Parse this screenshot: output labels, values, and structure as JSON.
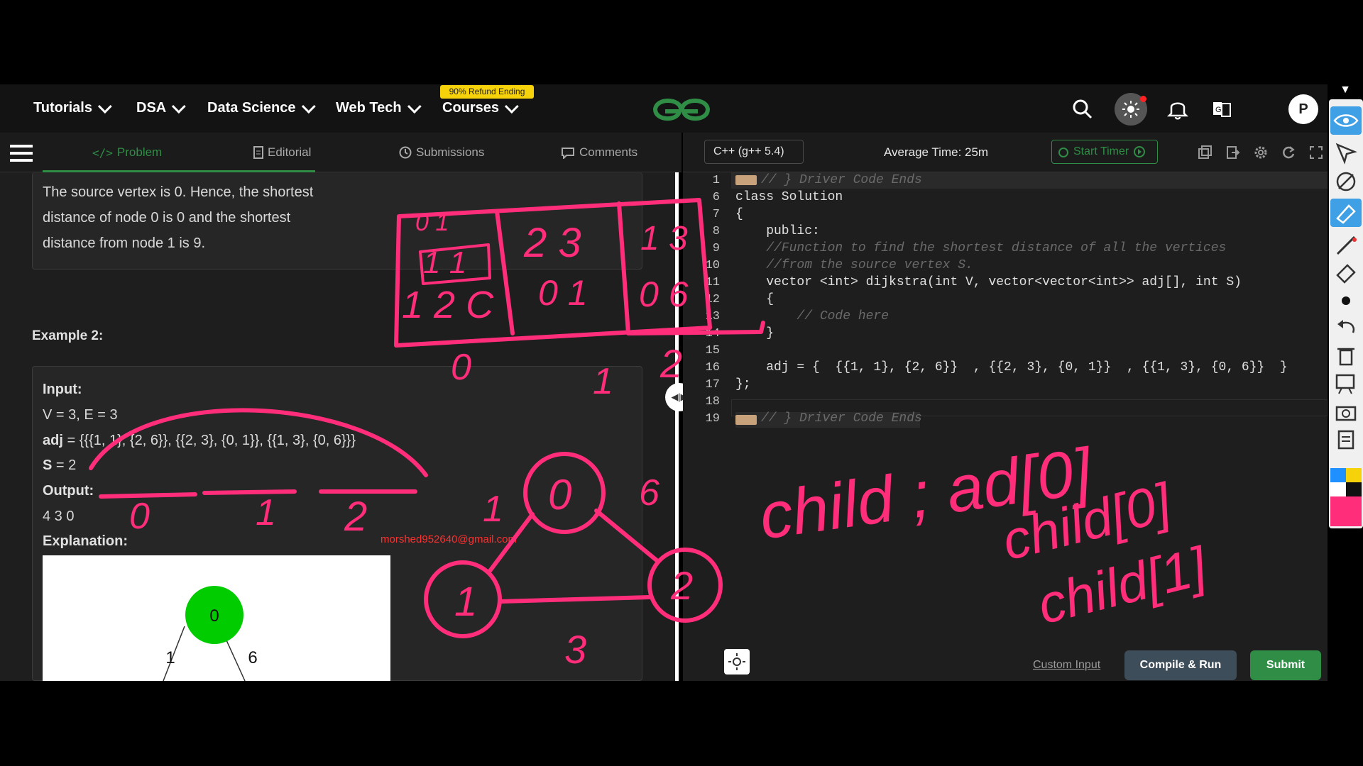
{
  "nav": {
    "items": [
      "Tutorials",
      "DSA",
      "Data Science",
      "Web Tech",
      "Courses"
    ],
    "badge": "90% Refund Ending",
    "avatar": "P"
  },
  "tabs": {
    "problem": "Problem",
    "editorial": "Editorial",
    "submissions": "Submissions",
    "comments": "Comments"
  },
  "editor_header": {
    "language": "C++ (g++ 5.4)",
    "average_time": "Average Time: 25m",
    "start_timer": "Start Timer"
  },
  "problem": {
    "explanation_text": [
      "The source vertex is 0. Hence, the shortest",
      "distance of node 0 is 0 and the shortest",
      "distance from node 1 is 9."
    ],
    "example_heading": "Example 2:",
    "input_label": "Input:",
    "v_e": "V = 3, E = 3",
    "adj_label": "adj",
    "adj_value": "= {{{1, 1}, {2, 6}}, {{2, 3}, {0, 1}}, {{1, 3}, {0, 6}}}",
    "s_label": "S",
    "s_value": "= 2",
    "output_label": "Output:",
    "output_value": "4 3 0",
    "explanation_label": "Explanation:",
    "graph": {
      "root": "0",
      "left_weight": "1",
      "right_weight": "6"
    }
  },
  "watermark": "morshed952640@gmail.com",
  "code": {
    "line_numbers": [
      "1",
      "6",
      "7",
      "8",
      "9",
      "10",
      "11",
      "12",
      "13",
      "14",
      "15",
      "16",
      "17",
      "18",
      "19"
    ],
    "lines": [
      "// } Driver Code Ends",
      "class Solution",
      "{",
      "    public:",
      "    //Function to find the shortest distance of all the vertices",
      "    //from the source vertex S.",
      "    vector <int> dijkstra(int V, vector<vector<int>> adj[], int S)",
      "    {",
      "        // Code here",
      "    }",
      "",
      "    adj = {  {{1, 1}, {2, 6}}  , {{2, 3}, {0, 1}}  , {{1, 3}, {0, 6}}  }",
      "};",
      "",
      "// } Driver Code Ends"
    ]
  },
  "bottom": {
    "custom_input": "Custom Input",
    "compile_run": "Compile & Run",
    "submit": "Submit"
  },
  "handwriting": {
    "table_top_left": "0  1",
    "table_mid_left": "1  1",
    "table_bottom_left": "1 2 C",
    "table_top_mid": "2  3",
    "table_bottom_mid": "0  1",
    "table_top_right": "1  3",
    "table_bottom_right": "0  6",
    "index_0": "0",
    "index_1": "1",
    "index_2": "2",
    "slot_0": "0",
    "slot_1": "1",
    "slot_2": "2",
    "node_0": "0",
    "node_1": "1",
    "node_2": "2",
    "edge_1": "1",
    "edge_6": "6",
    "edge_3": "3",
    "note_1": "child ; ad[0]",
    "note_2": "child[0]",
    "note_3": "child[1]"
  },
  "colors": {
    "accent_green": "#2f8d46",
    "ink_pink": "#ff2d7a",
    "node_green": "#00cc00"
  }
}
